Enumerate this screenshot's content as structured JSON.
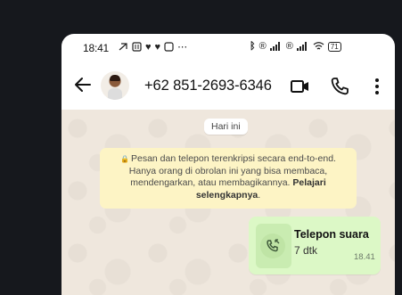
{
  "status_bar": {
    "time": "18:41",
    "left_glyphs": "⋯",
    "battery": "71"
  },
  "header": {
    "contact": "+62 851-2693-6346",
    "icons": [
      "back-arrow-icon",
      "video-call-icon",
      "phone-icon",
      "more-vert-icon"
    ]
  },
  "chat": {
    "date_chip": "Hari ini",
    "notice": {
      "text": "Pesan dan telepon terenkripsi secara end-to-end. Hanya orang di obrolan ini yang bisa membaca, mendengarkan, atau membagikannya.",
      "link": "Pelajari selengkapnya",
      "end": "."
    },
    "call": {
      "title": "Telepon suara",
      "duration": "7 dtk",
      "time": "18.41"
    }
  },
  "colors": {
    "chat_bg": "#efe7dd",
    "notice_bg": "#fdf4c5",
    "bubble_bg": "#dcf8c6"
  }
}
